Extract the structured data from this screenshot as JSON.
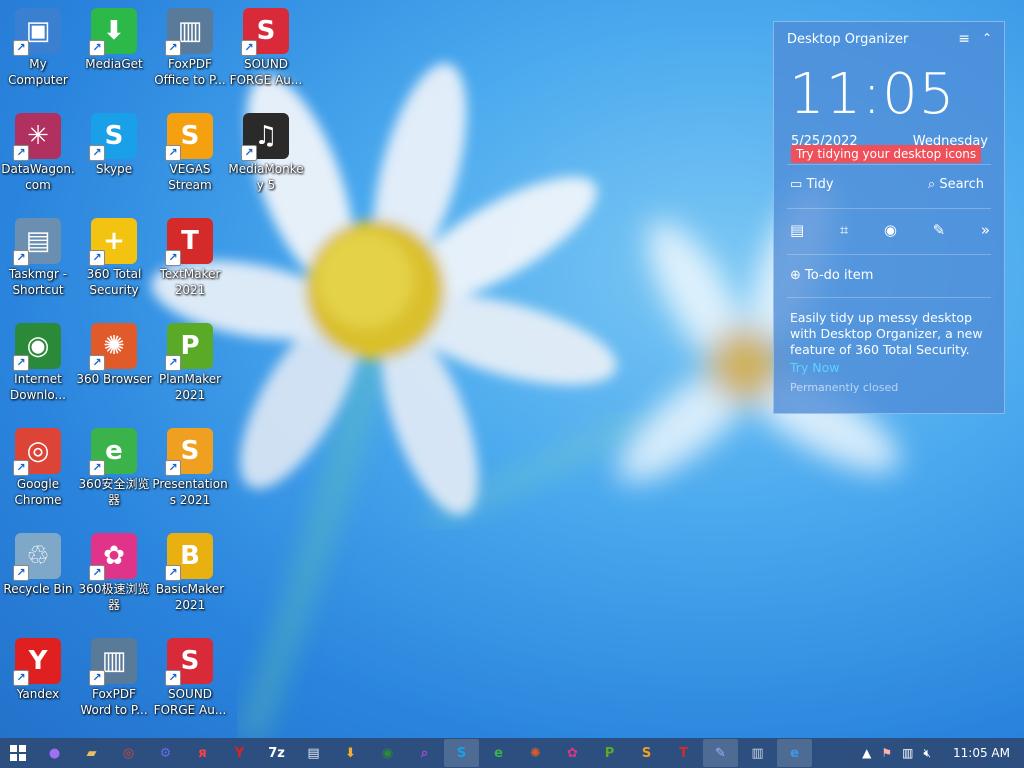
{
  "desktop_icons": [
    {
      "label": "My Computer",
      "icon": "computer-icon",
      "color": "#3a7fd0",
      "glyph": "▣"
    },
    {
      "label": "DataWagon.com",
      "icon": "datawagon-icon",
      "color": "#b03060",
      "glyph": "✳"
    },
    {
      "label": "Taskmgr - Shortcut",
      "icon": "task-manager-icon",
      "color": "#6a8fb0",
      "glyph": "▤"
    },
    {
      "label": "Internet Downlo...",
      "icon": "internet-download-manager-icon",
      "color": "#2a8a3a",
      "glyph": "◉"
    },
    {
      "label": "Google Chrome",
      "icon": "chrome-icon",
      "color": "#db4437",
      "glyph": "◎"
    },
    {
      "label": "Recycle Bin",
      "icon": "recycle-bin-icon",
      "color": "#7fa7c8",
      "glyph": "♲"
    },
    {
      "label": "Yandex",
      "icon": "yandex-icon",
      "color": "#e02020",
      "glyph": "Y"
    },
    {
      "label": "MediaGet",
      "icon": "mediaget-icon",
      "color": "#2db84a",
      "glyph": "⬇"
    },
    {
      "label": "Skype",
      "icon": "skype-icon",
      "color": "#1aa0e8",
      "glyph": "S"
    },
    {
      "label": "360 Total Security",
      "icon": "360-total-security-icon",
      "color": "#f2c310",
      "glyph": "+"
    },
    {
      "label": "360 Browser",
      "icon": "360-browser-icon",
      "color": "#e05a2a",
      "glyph": "✺"
    },
    {
      "label": "360安全浏览器",
      "icon": "360-safe-browser-icon",
      "color": "#3bb34a",
      "glyph": "e"
    },
    {
      "label": "360极速浏览器",
      "icon": "360-speed-browser-icon",
      "color": "#e0348a",
      "glyph": "✿"
    },
    {
      "label": "FoxPDF Word to P...",
      "icon": "foxpdf-word-icon",
      "color": "#5a7a9a",
      "glyph": "▥"
    },
    {
      "label": "FoxPDF Office to P...",
      "icon": "foxpdf-office-icon",
      "color": "#5a7a9a",
      "glyph": "▥"
    },
    {
      "label": "VEGAS Stream",
      "icon": "vegas-stream-icon",
      "color": "#f5a00f",
      "glyph": "S"
    },
    {
      "label": "TextMaker 2021",
      "icon": "textmaker-icon",
      "color": "#d42a2a",
      "glyph": "T"
    },
    {
      "label": "PlanMaker 2021",
      "icon": "planmaker-icon",
      "color": "#5aaa28",
      "glyph": "P"
    },
    {
      "label": "Presentations 2021",
      "icon": "presentations-icon",
      "color": "#f0a020",
      "glyph": "S"
    },
    {
      "label": "BasicMaker 2021",
      "icon": "basicmaker-icon",
      "color": "#e8b010",
      "glyph": "B"
    },
    {
      "label": "SOUND FORGE Au...",
      "icon": "sound-forge-icon",
      "color": "#d92a3a",
      "glyph": "S"
    },
    {
      "label": "SOUND FORGE Au...",
      "icon": "sound-forge-icon",
      "color": "#d92a3a",
      "glyph": "S"
    },
    {
      "label": "MediaMonkey 5",
      "icon": "mediamonkey-icon",
      "color": "#2a2a2a",
      "glyph": "♫"
    }
  ],
  "organizer": {
    "title": "Desktop Organizer",
    "time": "11:05",
    "date": "5/25/2022",
    "weekday": "Wednesday",
    "tip": "Try tidying your desktop icons",
    "tidy_label": "Tidy",
    "search_label": "Search",
    "todo_label": "To-do item",
    "description": "Easily tidy up messy desktop with Desktop Organizer, a new feature of 360 Total Security.",
    "try_label": "Try Now",
    "closed_label": "Permanently closed"
  },
  "taskbar": {
    "items": [
      {
        "name": "cortana-icon",
        "glyph": "●",
        "color": "#a070f0"
      },
      {
        "name": "file-explorer-icon",
        "glyph": "▰",
        "color": "#e8c060"
      },
      {
        "name": "chrome-icon",
        "glyph": "◎",
        "color": "#db4437"
      },
      {
        "name": "settings-icon",
        "glyph": "⚙",
        "color": "#6a6ae0"
      },
      {
        "name": "yandex-browser-icon",
        "glyph": "я",
        "color": "#ff4040"
      },
      {
        "name": "yandex-icon",
        "glyph": "Y",
        "color": "#e02020"
      },
      {
        "name": "7zip-icon",
        "glyph": "7z",
        "color": "#ffffff"
      },
      {
        "name": "notepad-icon",
        "glyph": "▤",
        "color": "#dfe8f0"
      },
      {
        "name": "mediaget-icon",
        "glyph": "⬇",
        "color": "#f2b030"
      },
      {
        "name": "idm-icon",
        "glyph": "◉",
        "color": "#2a8a3a"
      },
      {
        "name": "search-app-icon",
        "glyph": "⌕",
        "color": "#a050d0"
      },
      {
        "name": "skype-icon",
        "glyph": "S",
        "color": "#1aa0e8"
      },
      {
        "name": "360-safe-icon",
        "glyph": "e",
        "color": "#3bb34a"
      },
      {
        "name": "360-browser-icon",
        "glyph": "✺",
        "color": "#e05a2a"
      },
      {
        "name": "360-speed-icon",
        "glyph": "✿",
        "color": "#e0348a"
      },
      {
        "name": "planmaker-icon",
        "glyph": "P",
        "color": "#5aaa28"
      },
      {
        "name": "presentations-icon",
        "glyph": "S",
        "color": "#f0a020"
      },
      {
        "name": "textmaker-icon",
        "glyph": "T",
        "color": "#d42a2a"
      },
      {
        "name": "pen-tool-icon",
        "glyph": "✎",
        "color": "#a0b0ff"
      },
      {
        "name": "foxpdf-icon",
        "glyph": "▥",
        "color": "#c8d4e0"
      },
      {
        "name": "internet-explorer-icon",
        "glyph": "e",
        "color": "#3a9ae8"
      }
    ],
    "open_items": [
      11,
      18,
      20
    ],
    "clock": "11:05 AM"
  }
}
